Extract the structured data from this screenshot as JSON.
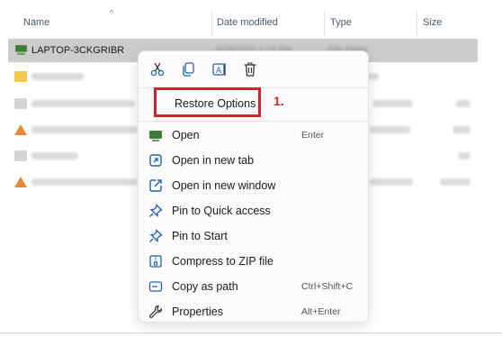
{
  "columns": {
    "name": "Name",
    "date_modified": "Date modified",
    "type": "Type",
    "size": "Size"
  },
  "rows": [
    {
      "name": "LAPTOP-3CKGRIBR",
      "date": "6/28/2022 1:18 PM",
      "type": "File folder",
      "icon": "computer-folder-icon",
      "selected": true
    }
  ],
  "quick_actions": [
    {
      "name": "cut-icon"
    },
    {
      "name": "copy-icon"
    },
    {
      "name": "rename-icon"
    },
    {
      "name": "delete-icon"
    }
  ],
  "menu": {
    "restore_options": "Restore Options",
    "items": [
      {
        "label": "Open",
        "shortcut": "Enter",
        "icon": "open-folder-icon"
      },
      {
        "label": "Open in new tab",
        "shortcut": "",
        "icon": "new-tab-icon"
      },
      {
        "label": "Open in new window",
        "shortcut": "",
        "icon": "new-window-icon"
      },
      {
        "label": "Pin to Quick access",
        "shortcut": "",
        "icon": "pin-icon"
      },
      {
        "label": "Pin to Start",
        "shortcut": "",
        "icon": "pin-start-icon"
      },
      {
        "label": "Compress to ZIP file",
        "shortcut": "",
        "icon": "zip-icon"
      },
      {
        "label": "Copy as path",
        "shortcut": "Ctrl+Shift+C",
        "icon": "copy-path-icon"
      },
      {
        "label": "Properties",
        "shortcut": "Alt+Enter",
        "icon": "properties-icon"
      }
    ]
  },
  "annotation": {
    "step": "1."
  },
  "colors": {
    "accent": "#d61f26",
    "selection": "#cccccc"
  }
}
